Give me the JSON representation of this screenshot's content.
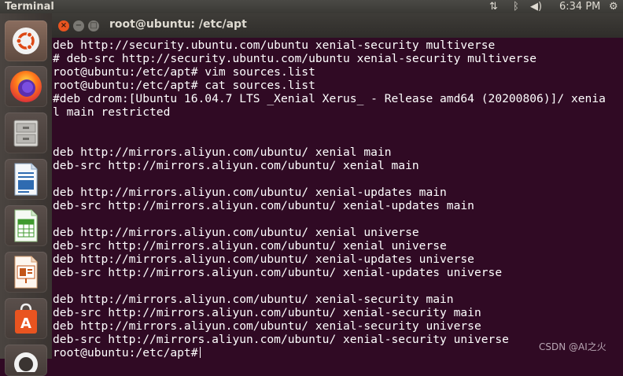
{
  "panel": {
    "app_title": "Terminal",
    "clock": "6:34 PM",
    "network_icon": "⇅",
    "bluetooth_icon": "ᛒ",
    "volume_icon": "◀)",
    "gear_icon": "⚙"
  },
  "window": {
    "title": "root@ubuntu: /etc/apt",
    "close_glyph": "×",
    "min_glyph": "−",
    "max_glyph": "□"
  },
  "launcher": {
    "items": [
      "ubuntu-dash",
      "firefox",
      "files",
      "libreoffice-writer",
      "libreoffice-calc",
      "libreoffice-impress",
      "ubuntu-software",
      "help"
    ]
  },
  "terminal": {
    "lines": [
      "deb http://security.ubuntu.com/ubuntu xenial-security multiverse",
      "# deb-src http://security.ubuntu.com/ubuntu xenial-security multiverse",
      "root@ubuntu:/etc/apt# vim sources.list",
      "root@ubuntu:/etc/apt# cat sources.list",
      "#deb cdrom:[Ubuntu 16.04.7 LTS _Xenial Xerus_ - Release amd64 (20200806)]/ xenia",
      "l main restricted",
      "",
      "",
      "deb http://mirrors.aliyun.com/ubuntu/ xenial main",
      "deb-src http://mirrors.aliyun.com/ubuntu/ xenial main",
      "",
      "deb http://mirrors.aliyun.com/ubuntu/ xenial-updates main",
      "deb-src http://mirrors.aliyun.com/ubuntu/ xenial-updates main",
      "",
      "deb http://mirrors.aliyun.com/ubuntu/ xenial universe",
      "deb-src http://mirrors.aliyun.com/ubuntu/ xenial universe",
      "deb http://mirrors.aliyun.com/ubuntu/ xenial-updates universe",
      "deb-src http://mirrors.aliyun.com/ubuntu/ xenial-updates universe",
      "",
      "deb http://mirrors.aliyun.com/ubuntu/ xenial-security main",
      "deb-src http://mirrors.aliyun.com/ubuntu/ xenial-security main",
      "deb http://mirrors.aliyun.com/ubuntu/ xenial-security universe",
      "deb-src http://mirrors.aliyun.com/ubuntu/ xenial-security universe"
    ],
    "prompt": "root@ubuntu:/etc/apt#",
    "watermark": "CSDN @AI之火"
  },
  "colors": {
    "terminal_bg": "#300a24",
    "accent": "#e95420"
  }
}
